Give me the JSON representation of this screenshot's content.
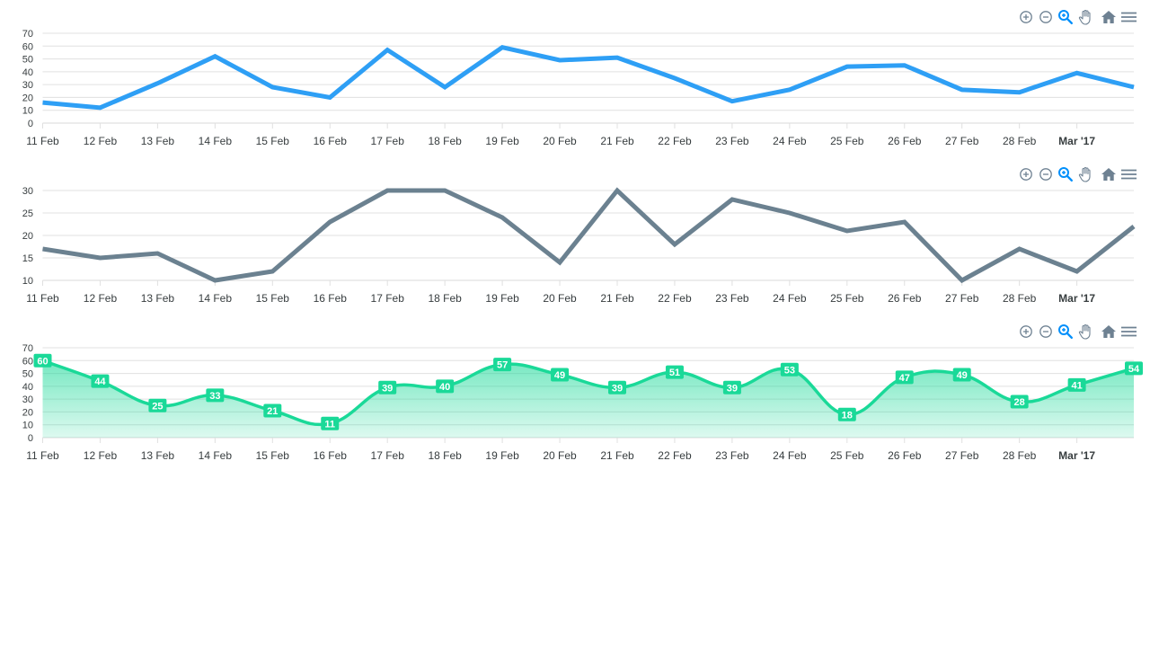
{
  "toolbar": {
    "icons": [
      "zoom-in-icon",
      "zoom-out-icon",
      "selection-zoom-icon",
      "pan-icon",
      "reset-home-icon",
      "menu-icon"
    ],
    "colors": {
      "default": "#6e8192",
      "active": "#008ffb"
    }
  },
  "chart_data": [
    {
      "type": "line",
      "categories": [
        "11 Feb",
        "12 Feb",
        "13 Feb",
        "14 Feb",
        "15 Feb",
        "16 Feb",
        "17 Feb",
        "18 Feb",
        "19 Feb",
        "20 Feb",
        "21 Feb",
        "22 Feb",
        "23 Feb",
        "24 Feb",
        "25 Feb",
        "26 Feb",
        "27 Feb",
        "28 Feb",
        "Mar '17"
      ],
      "bold_ticks": [
        "Mar '17"
      ],
      "series": [
        {
          "color": "#2e9ff5",
          "values": [
            16,
            12,
            31,
            52,
            28,
            20,
            57,
            28,
            59,
            49,
            51,
            35,
            17,
            26,
            44,
            45,
            26,
            24,
            39,
            28
          ]
        }
      ],
      "ylim": [
        0,
        70
      ],
      "yticks": [
        0,
        10,
        20,
        30,
        40,
        50,
        60,
        70
      ],
      "grid": true,
      "data_labels": false,
      "area": false
    },
    {
      "type": "line",
      "categories": [
        "11 Feb",
        "12 Feb",
        "13 Feb",
        "14 Feb",
        "15 Feb",
        "16 Feb",
        "17 Feb",
        "18 Feb",
        "19 Feb",
        "20 Feb",
        "21 Feb",
        "22 Feb",
        "23 Feb",
        "24 Feb",
        "25 Feb",
        "26 Feb",
        "27 Feb",
        "28 Feb",
        "Mar '17"
      ],
      "bold_ticks": [
        "Mar '17"
      ],
      "series": [
        {
          "color": "#6b8190",
          "values": [
            17,
            15,
            16,
            10,
            12,
            23,
            30,
            30,
            24,
            14,
            30,
            18,
            28,
            25,
            21,
            23,
            10,
            17,
            12,
            22
          ]
        }
      ],
      "ylim": [
        10,
        30
      ],
      "yticks": [
        10,
        15,
        20,
        25,
        30
      ],
      "grid": true,
      "data_labels": false,
      "area": false
    },
    {
      "type": "area",
      "categories": [
        "11 Feb",
        "12 Feb",
        "13 Feb",
        "14 Feb",
        "15 Feb",
        "16 Feb",
        "17 Feb",
        "18 Feb",
        "19 Feb",
        "20 Feb",
        "21 Feb",
        "22 Feb",
        "23 Feb",
        "24 Feb",
        "25 Feb",
        "26 Feb",
        "27 Feb",
        "28 Feb",
        "Mar '17"
      ],
      "bold_ticks": [
        "Mar '17"
      ],
      "series": [
        {
          "color": "#1ad998",
          "values": [
            60,
            44,
            25,
            33,
            21,
            11,
            39,
            40,
            57,
            49,
            39,
            51,
            39,
            53,
            18,
            47,
            49,
            28,
            41,
            54
          ]
        }
      ],
      "ylim": [
        0,
        70
      ],
      "yticks": [
        0,
        10,
        20,
        30,
        40,
        50,
        60,
        70
      ],
      "grid": true,
      "data_labels": true,
      "area": true
    }
  ]
}
